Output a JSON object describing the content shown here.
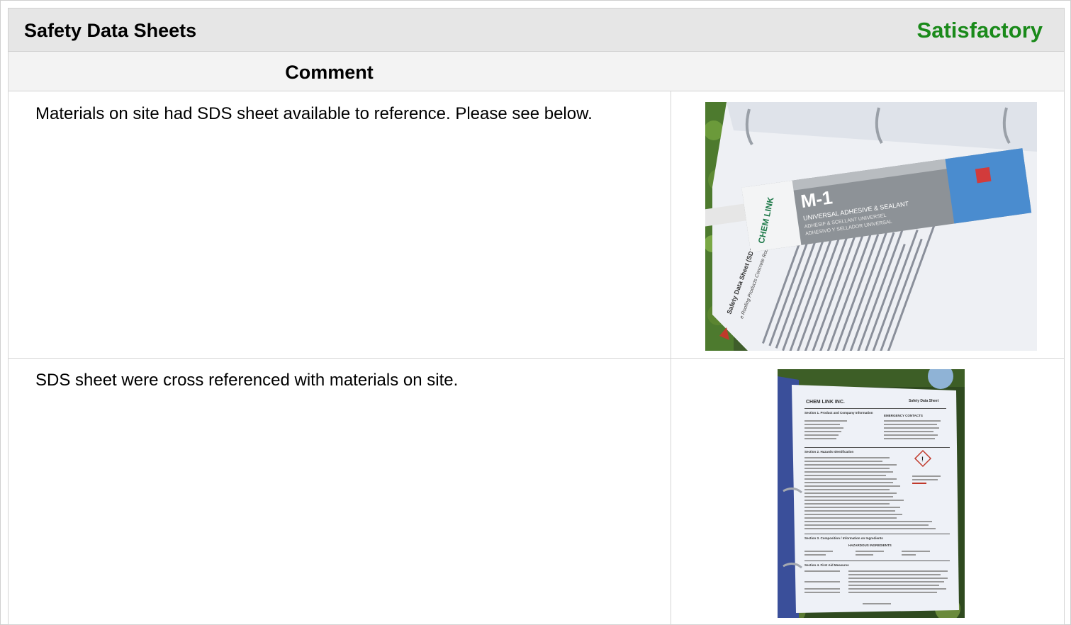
{
  "header": {
    "title": "Safety Data Sheets",
    "status": "Satisfactory",
    "status_color": "#1a8a1a"
  },
  "comment_header": {
    "label": "Comment"
  },
  "rows": [
    {
      "comment": "Materials on site had SDS sheet available to reference. Please see below.",
      "photo": {
        "binder_sheet_heading": "Safety Data Sheet (SDS)",
        "binder_sheet_subheading": "e Roofing Products Concrete Roof Tile",
        "tube_model": "M-1",
        "tube_brand": "CHEM LINK",
        "tube_desc_1": "UNIVERSAL ADHESIVE & SEALANT",
        "tube_desc_2": "ADHESIF & SCELLANT UNIVERSEL",
        "tube_desc_3": "ADHESIVO Y SELLADOR UNIVERSAL"
      }
    },
    {
      "comment": "SDS sheet were cross referenced with materials on site.",
      "photo": {
        "doc_company": "CHEM LINK INC.",
        "doc_title": "Safety Data Sheet",
        "doc_section_1": "Section 1. Product and Company Information",
        "doc_emergency": "EMERGENCY CONTACTS",
        "doc_section_2": "Section 2. Hazards Identification",
        "doc_section_3": "Section 3. Composition / Information on Ingredients",
        "doc_hazardous": "HAZARDOUS INGREDIENTS",
        "doc_section_4": "Section 4. First Aid Measures"
      }
    }
  ]
}
